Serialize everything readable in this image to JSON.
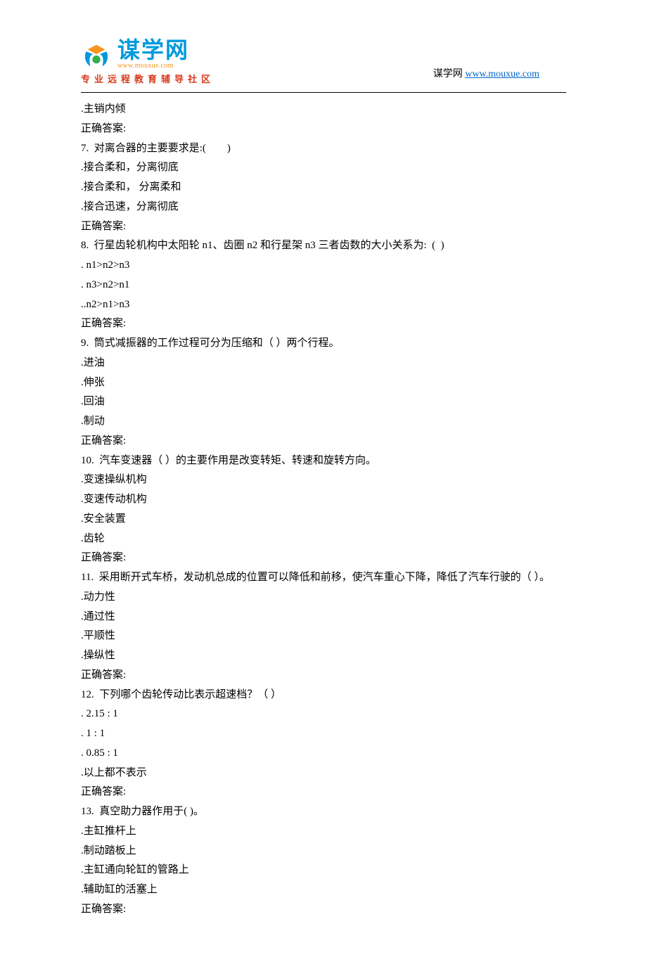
{
  "header": {
    "logo_cn": "谋学网",
    "logo_url": "www.mouxue.com",
    "tagline": "专业远程教育辅导社区",
    "right_prefix": "谋学网 ",
    "right_link_text": "www.mouxue.com",
    "right_link_href": "http://www.mouxue.com"
  },
  "lines": [
    ".主销内倾",
    "正确答案:",
    "7.  对离合器的主要要求是:(　　)",
    ".接合柔和，分离彻底",
    ".接合柔和， 分离柔和",
    ".接合迅速，分离彻底",
    "正确答案:",
    "8.  行星齿轮机构中太阳轮 n1、齿圈 n2 和行星架 n3 三者齿数的大小关系为:  (  )",
    ". n1>n2>n3",
    ". n3>n2>n1",
    "..n2>n1>n3",
    "正确答案:",
    "9.  筒式减振器的工作过程可分为压缩和（ ）两个行程。",
    ".进油",
    ".伸张",
    ".回油",
    ".制动",
    "正确答案:",
    "10.  汽车变速器（ ）的主要作用是改变转矩、转速和旋转方向。",
    ".变速操纵机构",
    ".变速传动机构",
    ".安全装置",
    ".齿轮",
    "正确答案:",
    "11.  采用断开式车桥，发动机总成的位置可以降低和前移，使汽车重心下降，降低了汽车行驶的（ ）。",
    ".动力性",
    ".通过性",
    ".平顺性",
    ".操纵性",
    "正确答案:",
    "12.  下列哪个齿轮传动比表示超速档？（ ）",
    ". 2.15 : 1",
    ". 1 : 1",
    ". 0.85 : 1",
    ".以上都不表示",
    "正确答案:",
    "13.  真空助力器作用于( )。",
    ".主缸推杆上",
    ".制动踏板上",
    ".主缸通向轮缸的管路上",
    ".辅助缸的活塞上",
    "正确答案:"
  ]
}
